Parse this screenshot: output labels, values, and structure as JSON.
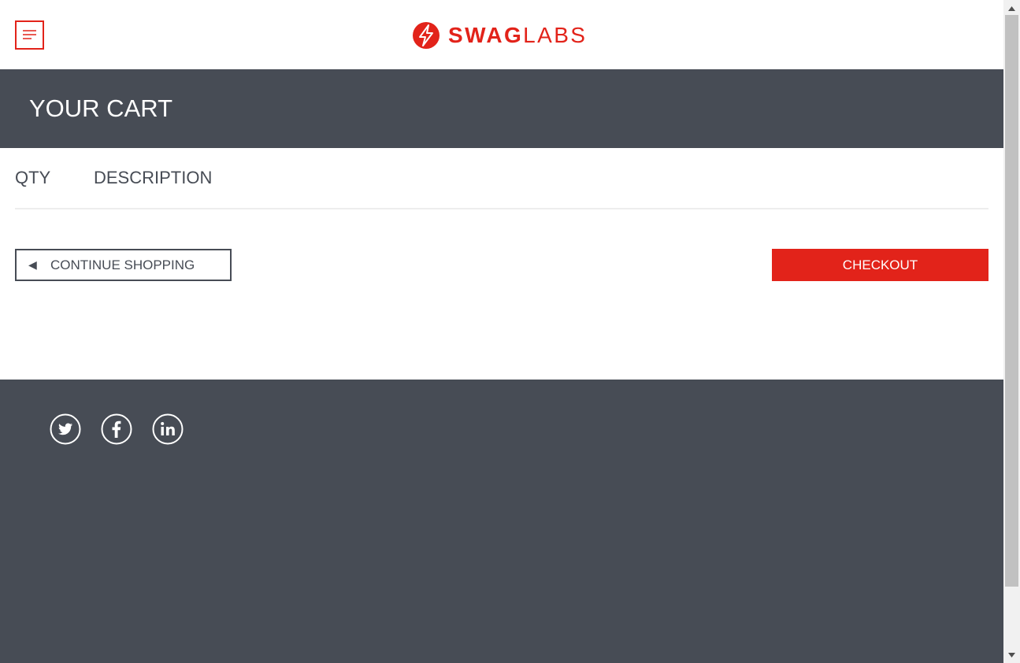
{
  "header": {
    "menu_label": "Open Menu",
    "logo": {
      "bold": "SWAG",
      "light": "LABS"
    }
  },
  "page": {
    "title": "YOUR CART"
  },
  "cart": {
    "columns": {
      "qty": "QTY",
      "description": "DESCRIPTION"
    },
    "items": []
  },
  "actions": {
    "continue_arrow": "◀",
    "continue_label": "CONTINUE SHOPPING",
    "checkout_label": "CHECKOUT"
  },
  "footer": {
    "social": [
      "twitter-icon",
      "facebook-icon",
      "linkedin-icon"
    ]
  },
  "colors": {
    "accent": "#e2231a",
    "dark": "#474c55"
  }
}
